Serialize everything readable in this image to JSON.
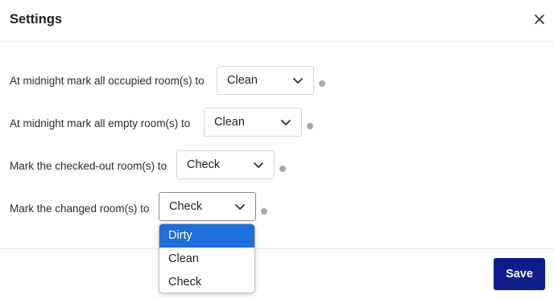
{
  "dialog": {
    "title": "Settings",
    "close_icon": "close-icon"
  },
  "settings": [
    {
      "label": "At midnight mark all occupied room(s) to",
      "value": "Clean",
      "info_icon": "info-icon"
    },
    {
      "label": "At midnight mark all empty room(s) to",
      "value": "Clean",
      "info_icon": "info-icon"
    },
    {
      "label": "Mark the checked-out room(s) to",
      "value": "Check",
      "info_icon": "info-icon"
    },
    {
      "label": "Mark the changed room(s) to",
      "value": "Check",
      "info_icon": "info-icon"
    }
  ],
  "dropdown": {
    "options": [
      {
        "label": "Dirty",
        "highlighted": true
      },
      {
        "label": "Clean",
        "highlighted": false
      },
      {
        "label": "Check",
        "highlighted": false
      }
    ]
  },
  "footer": {
    "save_label": "Save"
  },
  "colors": {
    "save_button": "#0e1d8c",
    "highlight": "#1e6fd9",
    "info_dot": "#a8a8a8"
  }
}
